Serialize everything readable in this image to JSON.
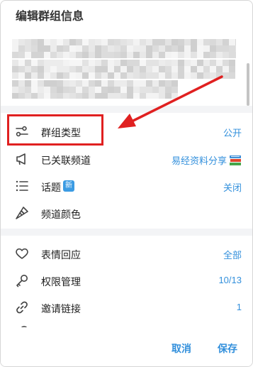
{
  "dialog": {
    "title": "编辑群组信息"
  },
  "settings": [
    {
      "label": "群组类型",
      "value": "公开",
      "icon": "sliders-icon"
    },
    {
      "label": "已关联频道",
      "value": "易经资料分享",
      "icon": "megaphone-icon",
      "extra_icon": "books-emoji-icon"
    },
    {
      "label": "话题",
      "badge": "新",
      "value": "关闭",
      "icon": "list-icon"
    },
    {
      "label": "频道颜色",
      "value": "",
      "icon": "brush-icon"
    }
  ],
  "permissions": [
    {
      "label": "表情回应",
      "value": "全部",
      "icon": "heart-icon"
    },
    {
      "label": "权限管理",
      "value": "10/13",
      "icon": "key-icon"
    },
    {
      "label": "邀请链接",
      "value": "1",
      "icon": "link-icon"
    }
  ],
  "footer": {
    "cancel_label": "取消",
    "save_label": "保存"
  },
  "colors": {
    "accent": "#3390dc",
    "annotation": "#e02020"
  }
}
